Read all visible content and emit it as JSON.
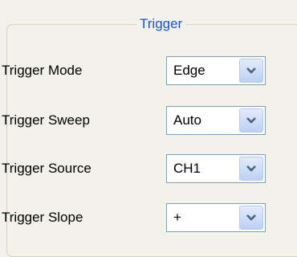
{
  "group": {
    "title": "Trigger"
  },
  "rows": [
    {
      "label": "Trigger Mode",
      "value": "Edge"
    },
    {
      "label": "Trigger Sweep",
      "value": "Auto"
    },
    {
      "label": "Trigger Source",
      "value": "CH1"
    },
    {
      "label": "Trigger Slope",
      "value": "+"
    }
  ],
  "icons": {
    "dropdown": "chevron-down-icon"
  },
  "colors": {
    "background": "#f2f1ea",
    "legend_text": "#1a54d4",
    "border": "#7f9db9",
    "chevron": "#4d6185"
  }
}
